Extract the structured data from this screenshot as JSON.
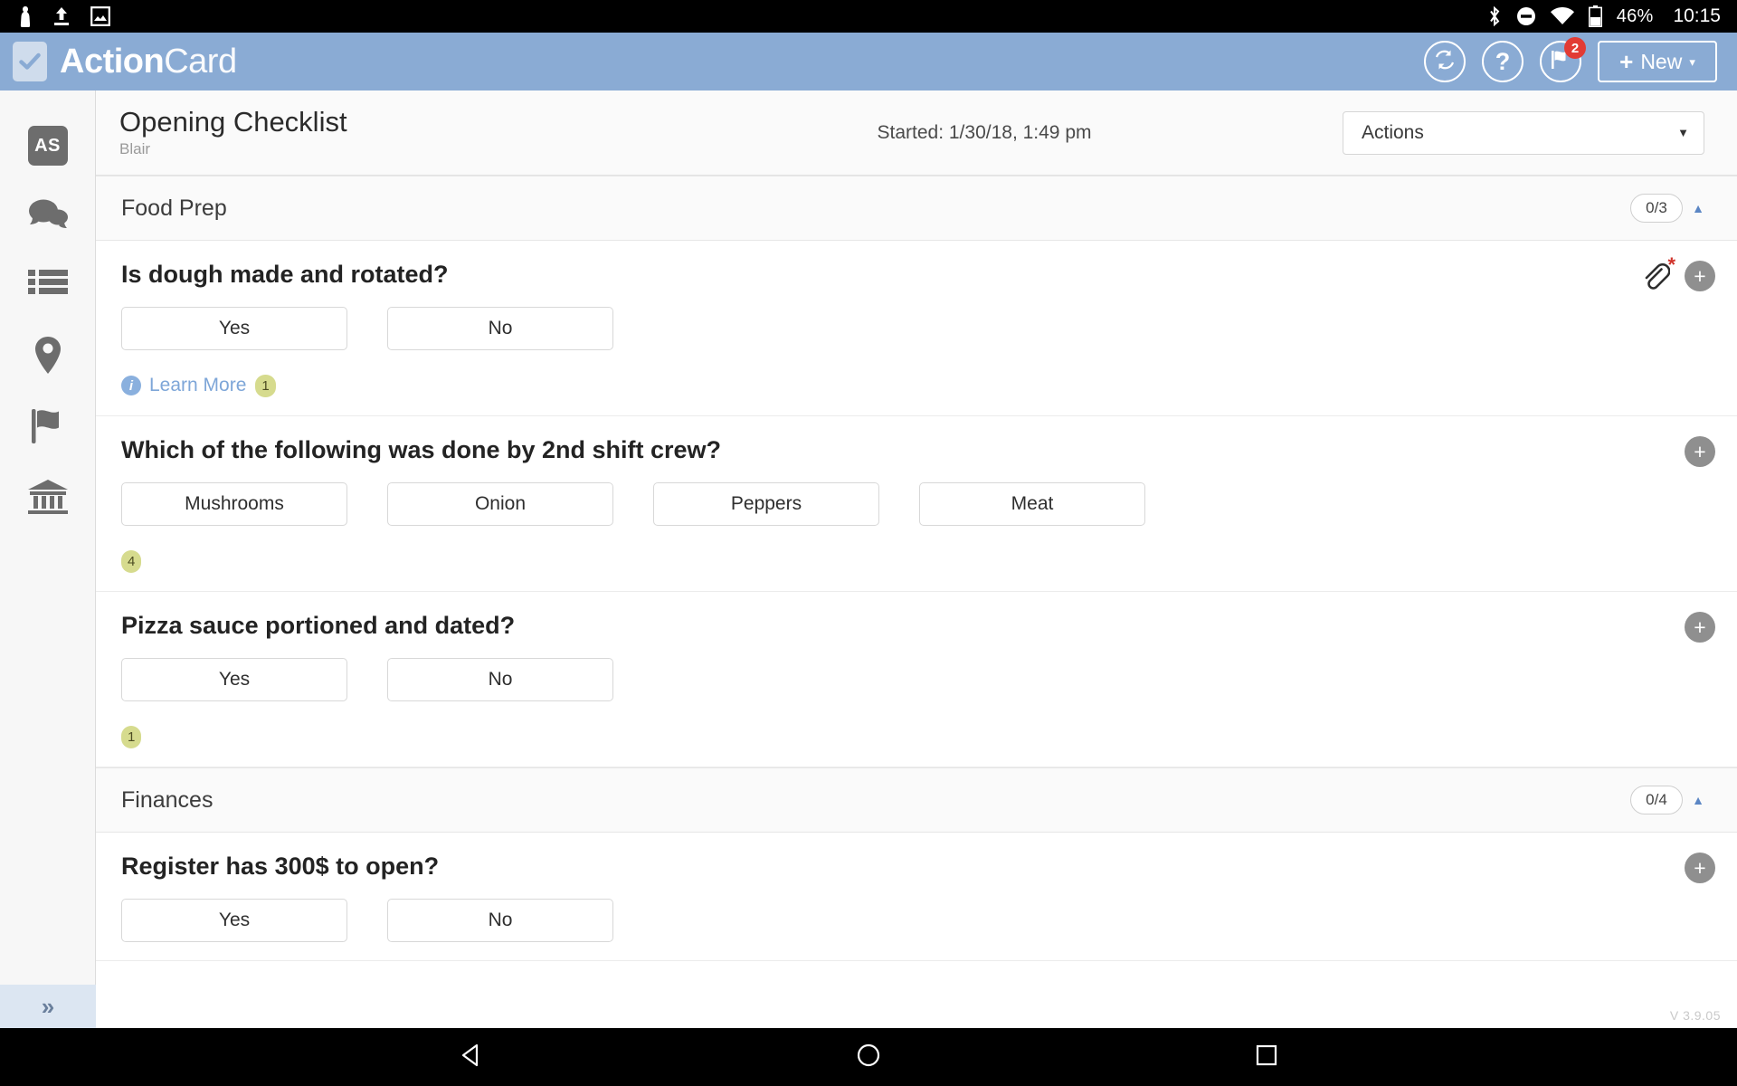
{
  "status_bar": {
    "left_icons": [
      "person-icon",
      "upload-icon",
      "image-icon"
    ],
    "right_icons": [
      "bluetooth-icon",
      "do-not-disturb-icon",
      "wifi-icon",
      "battery-icon"
    ],
    "battery": "46%",
    "time": "10:15"
  },
  "header": {
    "brand_bold": "Action",
    "brand_light": "Card",
    "logo_icon": "checkbox-check-icon",
    "sync_icon": "sync-icon",
    "help_icon": "question-mark-icon",
    "flag_icon": "flag-icon",
    "flag_badge": "2",
    "new_plus": "+",
    "new_label": "New",
    "new_caret": "▾",
    "background_color": "#8aabd4"
  },
  "sidebar": {
    "items": [
      {
        "name": "account-avatar",
        "label": "AS",
        "icon": "avatar-initials"
      },
      {
        "name": "messages",
        "label": "",
        "icon": "chat-bubbles-icon"
      },
      {
        "name": "checklists",
        "label": "",
        "icon": "list-icon"
      },
      {
        "name": "locations",
        "label": "",
        "icon": "map-pin-icon"
      },
      {
        "name": "flags",
        "label": "",
        "icon": "flag-icon"
      },
      {
        "name": "corporate",
        "label": "",
        "icon": "bank-icon"
      }
    ],
    "expand_label": "»"
  },
  "page": {
    "title": "Opening Checklist",
    "subtitle": "Blair",
    "started": "Started: 1/30/18, 1:49 pm",
    "actions_label": "Actions",
    "actions_caret": "▼",
    "version": "V 3.9.05"
  },
  "sections": [
    {
      "title": "Food Prep",
      "count": "0/3",
      "collapse_caret": "▲",
      "questions": [
        {
          "text": "Is dough made and rotated?",
          "options": [
            "Yes",
            "No"
          ],
          "learn_more": "Learn More",
          "learn_more_badge": "1",
          "badge": "",
          "has_attachment": true,
          "attachment_required": "*",
          "add_label": "+"
        },
        {
          "text": "Which of the following was done by 2nd shift crew?",
          "options": [
            "Mushrooms",
            "Onion",
            "Peppers",
            "Meat"
          ],
          "learn_more": "",
          "learn_more_badge": "",
          "badge": "4",
          "has_attachment": false,
          "attachment_required": "",
          "add_label": "+"
        },
        {
          "text": "Pizza sauce portioned and dated?",
          "options": [
            "Yes",
            "No"
          ],
          "learn_more": "",
          "learn_more_badge": "",
          "badge": "1",
          "has_attachment": false,
          "attachment_required": "",
          "add_label": "+"
        }
      ]
    },
    {
      "title": "Finances",
      "count": "0/4",
      "collapse_caret": "▲",
      "questions": [
        {
          "text": "Register has 300$ to open?",
          "options": [
            "Yes",
            "No"
          ],
          "learn_more": "",
          "learn_more_badge": "",
          "badge": "",
          "has_attachment": false,
          "attachment_required": "",
          "add_label": "+"
        }
      ]
    }
  ],
  "nav_bar": {
    "back_icon": "triangle-back-icon",
    "home_icon": "circle-home-icon",
    "recents_icon": "square-recents-icon"
  }
}
